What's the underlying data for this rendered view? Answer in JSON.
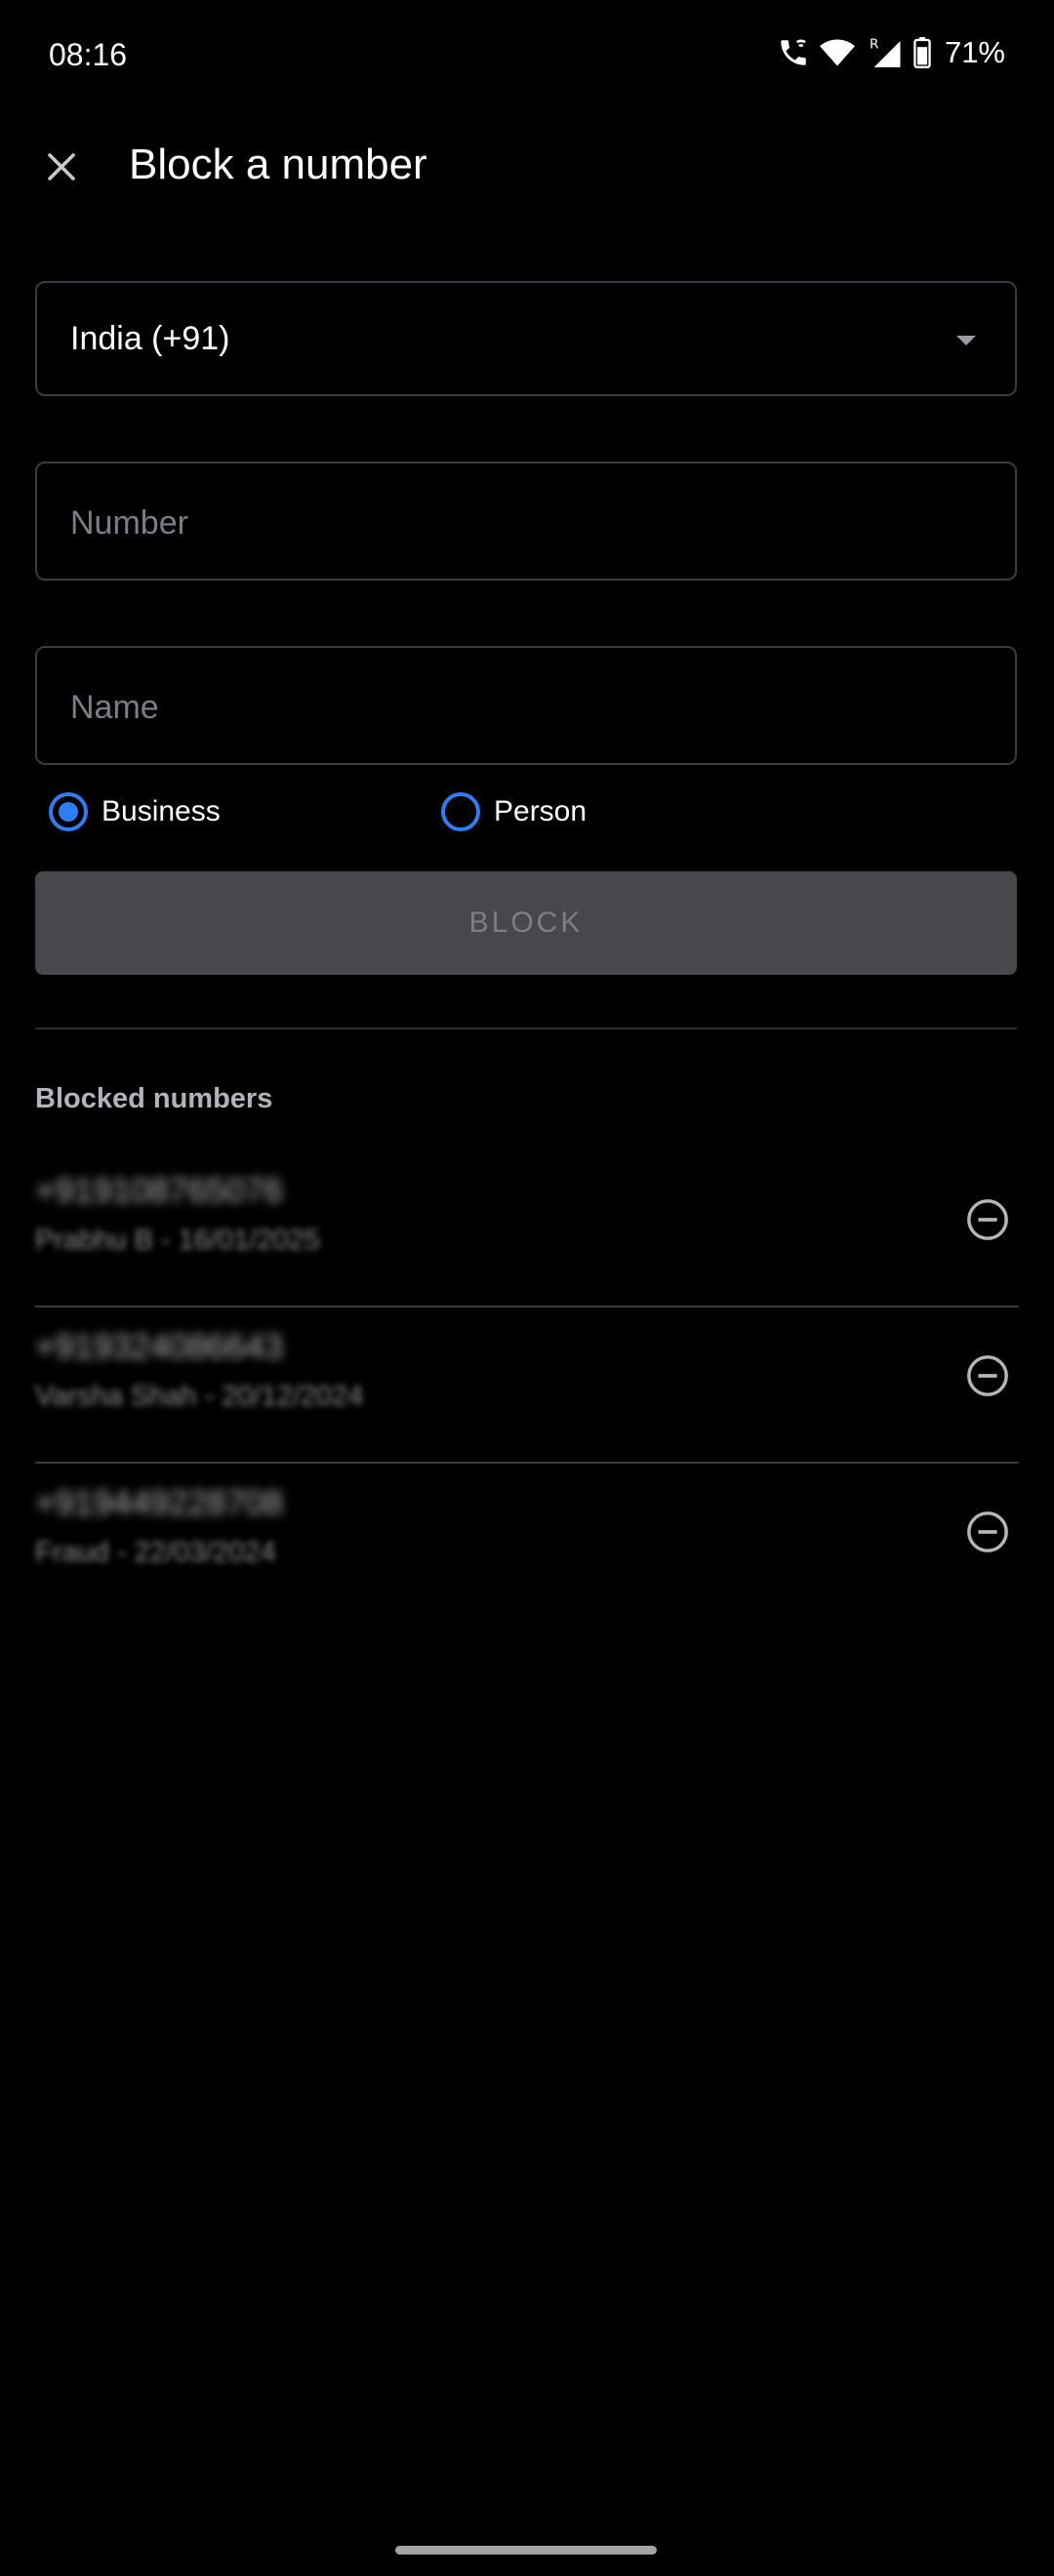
{
  "status_bar": {
    "time": "08:16",
    "battery": "71%",
    "icons": [
      "wifi-calling-icon",
      "wifi-icon",
      "signal-roaming-icon",
      "battery-icon"
    ]
  },
  "toolbar": {
    "title": "Block a number",
    "close_icon": "close-icon"
  },
  "form": {
    "country": "India (+91)",
    "number_placeholder": "Number",
    "name_placeholder": "Name",
    "type_options": [
      {
        "label": "Business",
        "selected": true
      },
      {
        "label": "Person",
        "selected": false
      }
    ],
    "block_label": "BLOCK"
  },
  "blocked_section": {
    "title": "Blocked numbers",
    "items": [
      {
        "number": "+919108765076",
        "meta": "Prabhu B - 16/01/2025"
      },
      {
        "number": "+919324086643",
        "meta": "Varsha Shah - 20/12/2024"
      },
      {
        "number": "+919449228708",
        "meta": "Fraud - 22/03/2024"
      }
    ]
  },
  "colors": {
    "background": "#000000",
    "accent": "#2e7df6",
    "border": "#3a3c40",
    "button_disabled": "#47484c"
  }
}
